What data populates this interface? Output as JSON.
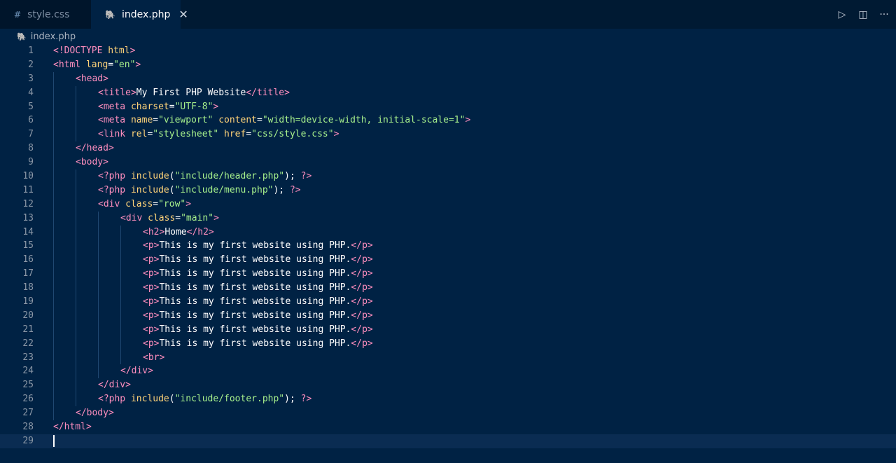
{
  "tabs": [
    {
      "label": "style.css",
      "icon": "hash-icon",
      "glyph": "#",
      "active": false
    },
    {
      "label": "index.php",
      "icon": "php-elephant-icon",
      "glyph": "🐘",
      "active": true,
      "close": "✕"
    }
  ],
  "actions": [
    {
      "name": "run-debug-icon",
      "glyph": "▷"
    },
    {
      "name": "split-editor-icon",
      "glyph": "◫"
    },
    {
      "name": "more-actions-icon",
      "glyph": "···"
    }
  ],
  "breadcrumb": {
    "file": "index.php"
  },
  "editor": {
    "current_line": 29,
    "lines": [
      {
        "n": "1",
        "indent": 0,
        "tokens": [
          [
            "tag",
            "<!DOCTYPE "
          ],
          [
            "attr",
            "html"
          ],
          [
            "tag",
            ">"
          ]
        ]
      },
      {
        "n": "2",
        "indent": 0,
        "tokens": [
          [
            "tag",
            "<html "
          ],
          [
            "attr",
            "lang"
          ],
          [
            "pun",
            "="
          ],
          [
            "str",
            "\"en\""
          ],
          [
            "tag",
            ">"
          ]
        ]
      },
      {
        "n": "3",
        "indent": 1,
        "tokens": [
          [
            "tag",
            "<head>"
          ]
        ]
      },
      {
        "n": "4",
        "indent": 2,
        "tokens": [
          [
            "tag",
            "<title>"
          ],
          [
            "txt",
            "My First PHP Website"
          ],
          [
            "tag",
            "</title>"
          ]
        ]
      },
      {
        "n": "5",
        "indent": 2,
        "tokens": [
          [
            "tag",
            "<meta "
          ],
          [
            "attr",
            "charset"
          ],
          [
            "pun",
            "="
          ],
          [
            "str",
            "\"UTF-8\""
          ],
          [
            "tag",
            ">"
          ]
        ]
      },
      {
        "n": "6",
        "indent": 2,
        "tokens": [
          [
            "tag",
            "<meta "
          ],
          [
            "attr",
            "name"
          ],
          [
            "pun",
            "="
          ],
          [
            "str",
            "\"viewport\""
          ],
          [
            "txt",
            " "
          ],
          [
            "attr",
            "content"
          ],
          [
            "pun",
            "="
          ],
          [
            "str",
            "\"width=device-width, initial-scale=1\""
          ],
          [
            "tag",
            ">"
          ]
        ]
      },
      {
        "n": "7",
        "indent": 2,
        "tokens": [
          [
            "tag",
            "<link "
          ],
          [
            "attr",
            "rel"
          ],
          [
            "pun",
            "="
          ],
          [
            "str",
            "\"stylesheet\""
          ],
          [
            "txt",
            " "
          ],
          [
            "attr",
            "href"
          ],
          [
            "pun",
            "="
          ],
          [
            "str",
            "\"css/style.css\""
          ],
          [
            "tag",
            ">"
          ]
        ]
      },
      {
        "n": "8",
        "indent": 1,
        "tokens": [
          [
            "tag",
            "</head>"
          ]
        ]
      },
      {
        "n": "9",
        "indent": 1,
        "tokens": [
          [
            "tag",
            "<body>"
          ]
        ]
      },
      {
        "n": "10",
        "indent": 2,
        "tokens": [
          [
            "php",
            "<?php "
          ],
          [
            "kw",
            "include"
          ],
          [
            "pun",
            "("
          ],
          [
            "str",
            "\"include/header.php\""
          ],
          [
            "pun",
            "); "
          ],
          [
            "php",
            "?>"
          ]
        ]
      },
      {
        "n": "11",
        "indent": 2,
        "tokens": [
          [
            "php",
            "<?php "
          ],
          [
            "kw",
            "include"
          ],
          [
            "pun",
            "("
          ],
          [
            "str",
            "\"include/menu.php\""
          ],
          [
            "pun",
            "); "
          ],
          [
            "php",
            "?>"
          ]
        ]
      },
      {
        "n": "12",
        "indent": 2,
        "tokens": [
          [
            "tag",
            "<div "
          ],
          [
            "attr",
            "class"
          ],
          [
            "pun",
            "="
          ],
          [
            "str",
            "\"row\""
          ],
          [
            "tag",
            ">"
          ]
        ]
      },
      {
        "n": "13",
        "indent": 3,
        "tokens": [
          [
            "tag",
            "<div "
          ],
          [
            "attr",
            "class"
          ],
          [
            "pun",
            "="
          ],
          [
            "str",
            "\"main\""
          ],
          [
            "tag",
            ">"
          ]
        ]
      },
      {
        "n": "14",
        "indent": 4,
        "tokens": [
          [
            "tag",
            "<h2>"
          ],
          [
            "txt",
            "Home"
          ],
          [
            "tag",
            "</h2>"
          ]
        ]
      },
      {
        "n": "15",
        "indent": 4,
        "tokens": [
          [
            "tag",
            "<p>"
          ],
          [
            "txt",
            "This is my first website using PHP."
          ],
          [
            "tag",
            "</p>"
          ]
        ]
      },
      {
        "n": "16",
        "indent": 4,
        "tokens": [
          [
            "tag",
            "<p>"
          ],
          [
            "txt",
            "This is my first website using PHP."
          ],
          [
            "tag",
            "</p>"
          ]
        ]
      },
      {
        "n": "17",
        "indent": 4,
        "tokens": [
          [
            "tag",
            "<p>"
          ],
          [
            "txt",
            "This is my first website using PHP."
          ],
          [
            "tag",
            "</p>"
          ]
        ]
      },
      {
        "n": "18",
        "indent": 4,
        "tokens": [
          [
            "tag",
            "<p>"
          ],
          [
            "txt",
            "This is my first website using PHP."
          ],
          [
            "tag",
            "</p>"
          ]
        ]
      },
      {
        "n": "19",
        "indent": 4,
        "tokens": [
          [
            "tag",
            "<p>"
          ],
          [
            "txt",
            "This is my first website using PHP."
          ],
          [
            "tag",
            "</p>"
          ]
        ]
      },
      {
        "n": "20",
        "indent": 4,
        "tokens": [
          [
            "tag",
            "<p>"
          ],
          [
            "txt",
            "This is my first website using PHP."
          ],
          [
            "tag",
            "</p>"
          ]
        ]
      },
      {
        "n": "21",
        "indent": 4,
        "tokens": [
          [
            "tag",
            "<p>"
          ],
          [
            "txt",
            "This is my first website using PHP."
          ],
          [
            "tag",
            "</p>"
          ]
        ]
      },
      {
        "n": "22",
        "indent": 4,
        "tokens": [
          [
            "tag",
            "<p>"
          ],
          [
            "txt",
            "This is my first website using PHP."
          ],
          [
            "tag",
            "</p>"
          ]
        ]
      },
      {
        "n": "23",
        "indent": 4,
        "tokens": [
          [
            "tag",
            "<br>"
          ]
        ]
      },
      {
        "n": "24",
        "indent": 3,
        "tokens": [
          [
            "tag",
            "</div>"
          ]
        ]
      },
      {
        "n": "25",
        "indent": 2,
        "tokens": [
          [
            "tag",
            "</div>"
          ]
        ]
      },
      {
        "n": "26",
        "indent": 2,
        "tokens": [
          [
            "php",
            "<?php "
          ],
          [
            "kw",
            "include"
          ],
          [
            "pun",
            "("
          ],
          [
            "str",
            "\"include/footer.php\""
          ],
          [
            "pun",
            "); "
          ],
          [
            "php",
            "?>"
          ]
        ]
      },
      {
        "n": "27",
        "indent": 1,
        "tokens": [
          [
            "tag",
            "</body>"
          ]
        ]
      },
      {
        "n": "28",
        "indent": 0,
        "tokens": [
          [
            "tag",
            "</html>"
          ]
        ]
      },
      {
        "n": "29",
        "indent": 0,
        "tokens": []
      }
    ]
  },
  "colors": {
    "background": "#002244",
    "tabbar": "#001a33",
    "tag": "#ff8fbf",
    "attribute": "#ffd479",
    "string": "#a6f08c",
    "text": "#ffffff",
    "line_number": "#8a97a6"
  }
}
